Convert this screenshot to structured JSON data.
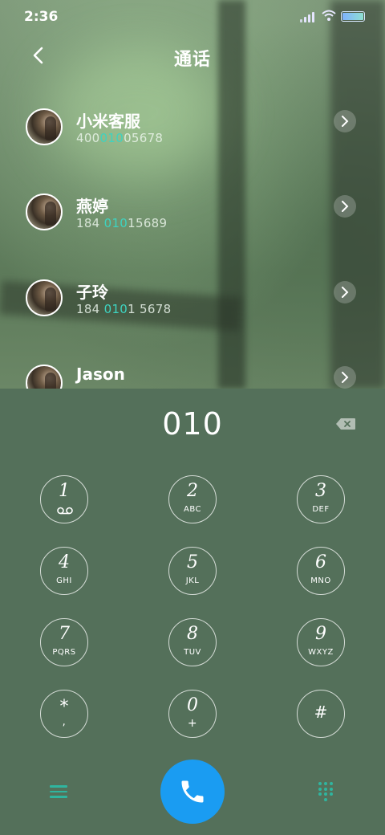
{
  "status_bar": {
    "time": "2:36"
  },
  "header": {
    "title": "通话"
  },
  "contacts": [
    {
      "name": "小米客服",
      "number_pre": "400",
      "number_hl": "010",
      "number_post": "05678"
    },
    {
      "name": "燕婷",
      "number_pre": "184 ",
      "number_hl": "010",
      "number_post": "15689"
    },
    {
      "name": "子玲",
      "number_pre": "184 ",
      "number_hl": "010",
      "number_post": "1 5678"
    },
    {
      "name": "Jason",
      "number_pre": "",
      "number_hl": "",
      "number_post": ""
    }
  ],
  "dialer": {
    "entered": "010",
    "keys": [
      {
        "digit": "1",
        "sub": ""
      },
      {
        "digit": "2",
        "sub": "ABC"
      },
      {
        "digit": "3",
        "sub": "DEF"
      },
      {
        "digit": "4",
        "sub": "GHI"
      },
      {
        "digit": "5",
        "sub": "JKL"
      },
      {
        "digit": "6",
        "sub": "MNO"
      },
      {
        "digit": "7",
        "sub": "PQRS"
      },
      {
        "digit": "8",
        "sub": "TUV"
      },
      {
        "digit": "9",
        "sub": "WXYZ"
      },
      {
        "digit": "*",
        "sub": ","
      },
      {
        "digit": "0",
        "sub": "+"
      },
      {
        "digit": "#",
        "sub": ""
      }
    ]
  },
  "icons": {
    "back": "chevron-left-icon",
    "delete": "backspace-icon",
    "voicemail": "voicemail-icon",
    "call": "phone-icon",
    "menu": "menu-icon",
    "keypad": "dialpad-icon"
  },
  "colors": {
    "panel_bg": "#54705a",
    "highlight": "#3ed3c0",
    "call_button": "#1a9cf2",
    "accent_icons": "#2fb59f"
  }
}
